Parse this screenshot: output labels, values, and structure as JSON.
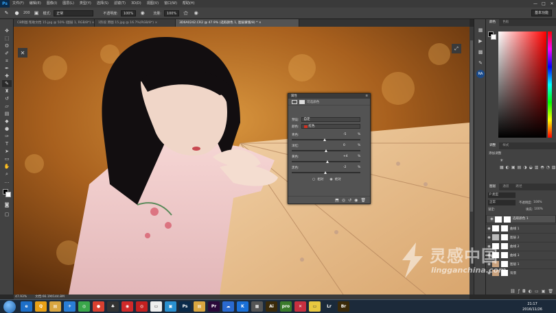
{
  "app": {
    "logo": "Ps",
    "workspace": "基本功能",
    "window_controls": [
      "—",
      "□",
      "✕"
    ]
  },
  "menu": [
    "文件(F)",
    "编辑(E)",
    "图像(I)",
    "图层(L)",
    "类型(Y)",
    "选择(S)",
    "滤镜(T)",
    "3D(D)",
    "视图(V)",
    "窗口(W)",
    "帮助(H)"
  ],
  "options": {
    "mode_label": "模式:",
    "mode_value": "正常",
    "opacity_label": "不透明度:",
    "opacity_value": "100%",
    "flow_label": "流量:",
    "flow_value": "100%",
    "brush_size": "200"
  },
  "tabs": [
    {
      "label": "CB制图 帮助文档 15.jpg @ 50% (图层 1, RGB/8*) ×",
      "active": false
    },
    {
      "label": "1阶段 原图 15.jpg @ 16.7%(RGB/8*) ×",
      "active": false
    },
    {
      "label": "3D6A0242.CR2 @ 47.9% (选取颜色 1, 图层蒙版/8) * ×",
      "active": true
    }
  ],
  "canvas": {
    "zoom": "47.93%",
    "doc_size": "文档:66.1M/144.8M"
  },
  "properties": {
    "title": "属性",
    "subtitle": "可选颜色",
    "preset_label": "预设:",
    "preset_value": "自定",
    "colors_label": "颜色:",
    "colors_value": "红色",
    "colors_swatch": "#d23020",
    "sliders": [
      {
        "label": "青色:",
        "value": "-5",
        "pct": "%",
        "level": 0.475
      },
      {
        "label": "洋红:",
        "value": "0",
        "pct": "%",
        "level": 0.5
      },
      {
        "label": "黄色:",
        "value": "+4",
        "pct": "%",
        "level": 0.52
      },
      {
        "label": "黑色:",
        "value": "-2",
        "pct": "%",
        "level": 0.49
      }
    ],
    "method": [
      {
        "label": "相对",
        "checked": false
      },
      {
        "label": "绝对",
        "checked": true
      }
    ]
  },
  "color_panel": {
    "tabs": [
      "颜色",
      "色板"
    ]
  },
  "adjust_panel": {
    "tabs": [
      "调整",
      "样式"
    ],
    "add_label": "添加调整"
  },
  "layers_panel": {
    "tabs": [
      "图层",
      "通道",
      "路径"
    ],
    "filter": "P 类型",
    "blend": "正常",
    "opacity_label": "不透明度:",
    "opacity_value": "100%",
    "lock_label": "锁定:",
    "fill_label": "填充:",
    "fill_value": "100%",
    "layers": [
      {
        "name": "选取颜色 1",
        "selected": true,
        "thumb": "#ffffff"
      },
      {
        "name": "曲线 1",
        "selected": false,
        "thumb": "#ffffff"
      },
      {
        "name": "图层 2",
        "selected": false,
        "thumb": "#bbbbbb"
      },
      {
        "name": "曲线 2",
        "selected": false,
        "thumb": "#ffffff"
      },
      {
        "name": "曲线 3",
        "selected": false,
        "thumb": "#ffffff"
      },
      {
        "name": "图层 1",
        "selected": false,
        "thumb": "#c9a27e"
      },
      {
        "name": "背景",
        "selected": false,
        "thumb": "#c9a27e"
      }
    ]
  },
  "watermark": {
    "cn": "灵感中国",
    "en": "lingganchina.com"
  },
  "taskbar": {
    "time": "21:17",
    "date": "2016/11/26",
    "apps": [
      {
        "name": "IE",
        "label": "e",
        "color": "#1e6fc8"
      },
      {
        "name": "qq",
        "label": "Q",
        "color": "#e8a016"
      },
      {
        "name": "folder",
        "label": "▤",
        "color": "#d9a640"
      },
      {
        "name": "bird",
        "label": "✈",
        "color": "#2a7ed6"
      },
      {
        "name": "360",
        "label": "◎",
        "color": "#3aa64a"
      },
      {
        "name": "chrome",
        "label": "●",
        "color": "#d84030"
      },
      {
        "name": "qq2",
        "label": "♣",
        "color": "#333333"
      },
      {
        "name": "weibo",
        "label": "◉",
        "color": "#d02a2a"
      },
      {
        "name": "netease",
        "label": "◎",
        "color": "#c42020"
      },
      {
        "name": "doc",
        "label": "▭",
        "color": "#eeeeee"
      },
      {
        "name": "monitor",
        "label": "▣",
        "color": "#2a90d0"
      },
      {
        "name": "ps",
        "label": "Ps",
        "color": "#0a2a4a"
      },
      {
        "name": "folder2",
        "label": "▤",
        "color": "#d9a640"
      },
      {
        "name": "pr",
        "label": "Pr",
        "color": "#2a0a3a"
      },
      {
        "name": "cloud",
        "label": "☁",
        "color": "#2a6ad0"
      },
      {
        "name": "kugou",
        "label": "K",
        "color": "#1a70d8"
      },
      {
        "name": "pdf",
        "label": "▦",
        "color": "#555555"
      },
      {
        "name": "ai",
        "label": "Ai",
        "color": "#3a2a0a"
      },
      {
        "name": "profbot",
        "label": "pro",
        "color": "#3a7a2a"
      },
      {
        "name": "xmind",
        "label": "✕",
        "color": "#c83040"
      },
      {
        "name": "note",
        "label": "▭",
        "color": "#e8c840"
      },
      {
        "name": "lr",
        "label": "Lr",
        "color": "#1a2a3a"
      },
      {
        "name": "br",
        "label": "Br",
        "color": "#3a2a0a"
      }
    ]
  }
}
